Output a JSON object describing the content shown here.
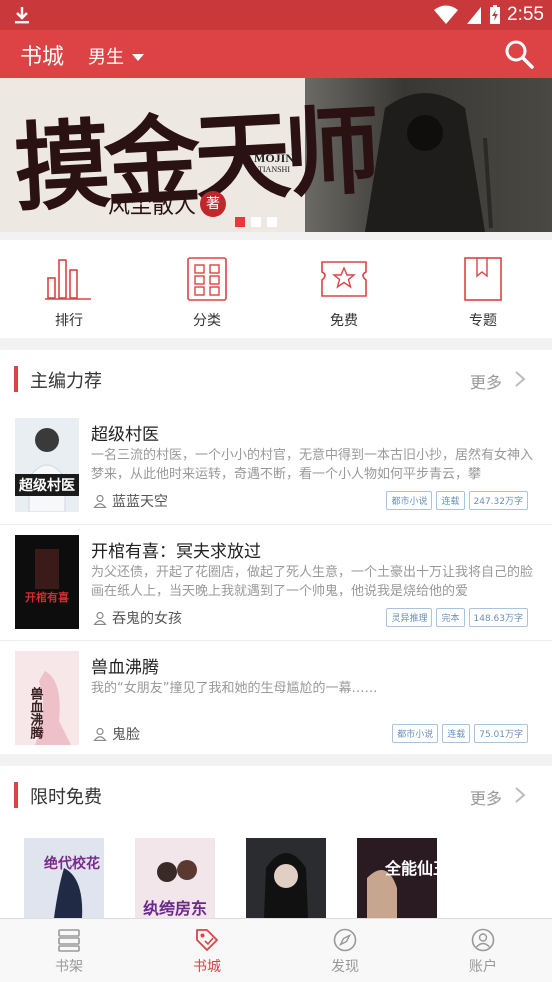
{
  "status": {
    "time": "2:55"
  },
  "appbar": {
    "title": "书城",
    "gender": "男生"
  },
  "banner": {
    "title": "摸金天师",
    "author": "风尘散人",
    "author_mark": "著",
    "en_line1": "MOJIN",
    "en_line2": "TIANSHI"
  },
  "categories": [
    {
      "label": "排行",
      "icon": "bar-chart-icon"
    },
    {
      "label": "分类",
      "icon": "grid-icon"
    },
    {
      "label": "免费",
      "icon": "star-ticket-icon"
    },
    {
      "label": "专题",
      "icon": "bookmark-icon"
    }
  ],
  "featured": {
    "title": "主编力荐",
    "more": "更多",
    "books": [
      {
        "title": "超级村医",
        "desc": "一名三流的村医，一个小小的村官，无意中得到一本古旧小抄，居然有女神入梦来，从此他时来运转，奇遇不断，看一个小人物如何平步青云，攀",
        "author": "蓝蓝天空",
        "tags": [
          "都市小说",
          "连载",
          "247.32万字"
        ],
        "cover_text": "超级村医"
      },
      {
        "title": "开棺有喜：冥夫求放过",
        "desc": "为父还债，开起了花圈店，做起了死人生意，一个土豪出十万让我将自己的脸画在纸人上，当天晚上我就遇到了一个帅鬼，他说我是烧给他的爱",
        "author": "吞鬼的女孩",
        "tags": [
          "灵异推理",
          "完本",
          "148.63万字"
        ],
        "cover_text": "开棺有喜"
      },
      {
        "title": "兽血沸腾",
        "desc": "我的“女朋友”撞见了我和她的生母尴尬的一幕……",
        "author": "鬼脸",
        "tags": [
          "都市小说",
          "连载",
          "75.01万字"
        ],
        "cover_text": "兽血沸腾"
      }
    ]
  },
  "free": {
    "title": "限时免费",
    "more": "更多",
    "covers": [
      "绝代校花",
      "纨绔房东",
      "",
      "全能仙王"
    ]
  },
  "tabs": [
    {
      "label": "书架",
      "icon": "bookshelf-icon",
      "active": false
    },
    {
      "label": "书城",
      "icon": "store-tag-icon",
      "active": true
    },
    {
      "label": "发现",
      "icon": "compass-icon",
      "active": false
    },
    {
      "label": "账户",
      "icon": "account-icon",
      "active": false
    }
  ]
}
